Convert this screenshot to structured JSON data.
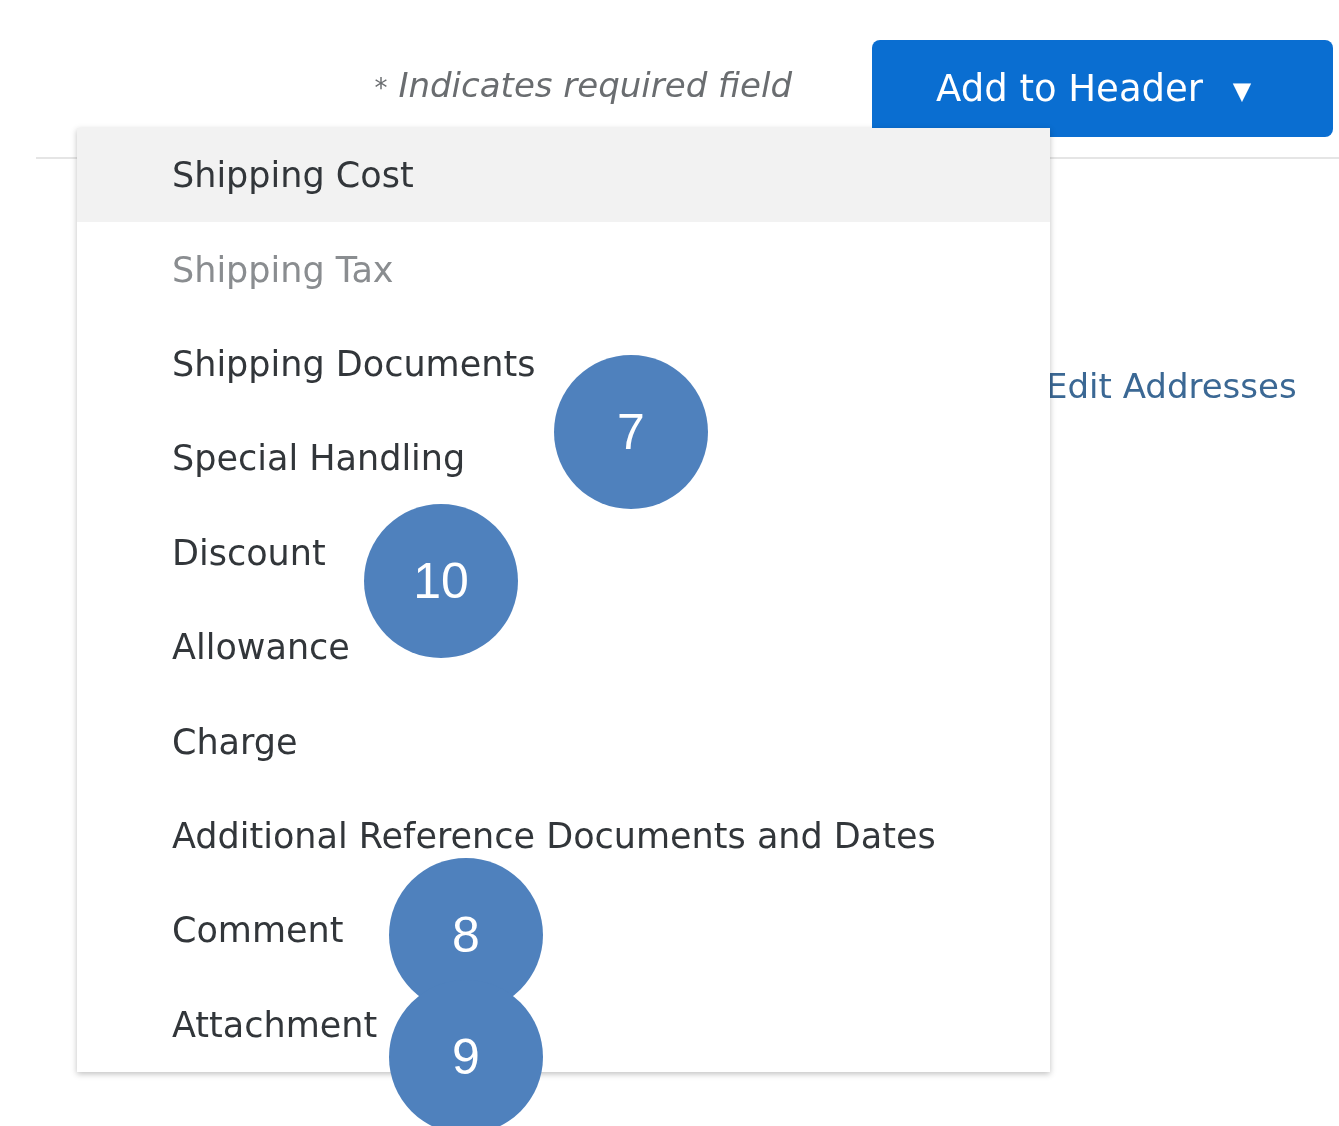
{
  "required_note": {
    "marker": "*",
    "text": "Indicates required field"
  },
  "add_button": {
    "label": "Add to Header",
    "caret": "▼"
  },
  "edit_link": "Edit Addresses",
  "menu": [
    {
      "label": "Shipping Cost",
      "selected": true,
      "disabled": false
    },
    {
      "label": "Shipping Tax",
      "selected": false,
      "disabled": true
    },
    {
      "label": "Shipping Documents",
      "selected": false,
      "disabled": false
    },
    {
      "label": "Special Handling",
      "selected": false,
      "disabled": false
    },
    {
      "label": "Discount",
      "selected": false,
      "disabled": false
    },
    {
      "label": "Allowance",
      "selected": false,
      "disabled": false
    },
    {
      "label": "Charge",
      "selected": false,
      "disabled": false
    },
    {
      "label": "Additional Reference Documents and Dates",
      "selected": false,
      "disabled": false
    },
    {
      "label": "Comment",
      "selected": false,
      "disabled": false
    },
    {
      "label": "Attachment",
      "selected": false,
      "disabled": false
    }
  ],
  "callouts": [
    {
      "label": "7"
    },
    {
      "label": "10"
    },
    {
      "label": "8"
    },
    {
      "label": "9"
    }
  ]
}
